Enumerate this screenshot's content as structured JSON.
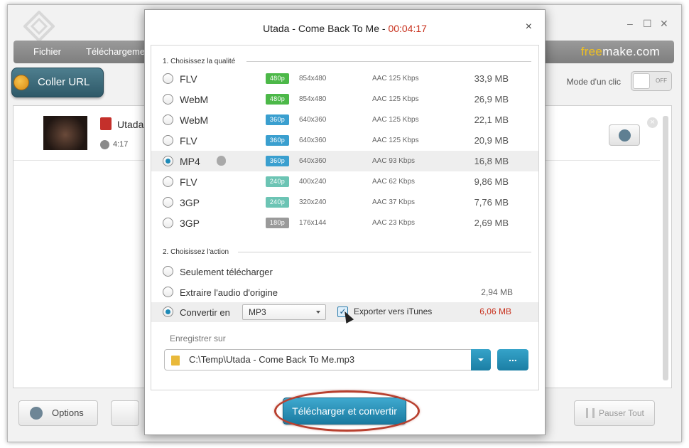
{
  "main_window": {
    "menu": [
      "Fichier",
      "Téléchargeme"
    ],
    "brand": {
      "prefix": "free",
      "suffix": "make.com"
    },
    "paste_url_label": "Coller URL",
    "one_click": {
      "label": "Mode d'un clic",
      "state": "OFF"
    },
    "item": {
      "title": "Utada",
      "duration": "4:17"
    },
    "options_label": "Options",
    "pause_all_label": "Pauser Tout"
  },
  "dialog": {
    "title": "Utada - Come Back To Me",
    "time": "00:04:17",
    "close": "×",
    "section1": "1. Choisissez la qualité",
    "qualities": [
      {
        "format": "FLV",
        "badge": "480p",
        "badge_color": "#4cb848",
        "resolution": "854x480",
        "audio": "AAC 125  Kbps",
        "size": "33,9 MB",
        "selected": false,
        "apple": false
      },
      {
        "format": "WebM",
        "badge": "480p",
        "badge_color": "#4cb848",
        "resolution": "854x480",
        "audio": "AAC 125  Kbps",
        "size": "26,9 MB",
        "selected": false,
        "apple": false
      },
      {
        "format": "WebM",
        "badge": "360p",
        "badge_color": "#3a9fcf",
        "resolution": "640x360",
        "audio": "AAC 125  Kbps",
        "size": "22,1 MB",
        "selected": false,
        "apple": false
      },
      {
        "format": "FLV",
        "badge": "360p",
        "badge_color": "#3a9fcf",
        "resolution": "640x360",
        "audio": "AAC 125  Kbps",
        "size": "20,9 MB",
        "selected": false,
        "apple": false
      },
      {
        "format": "MP4",
        "badge": "360p",
        "badge_color": "#3a9fcf",
        "resolution": "640x360",
        "audio": "AAC 93  Kbps",
        "size": "16,8 MB",
        "selected": true,
        "apple": true
      },
      {
        "format": "FLV",
        "badge": "240p",
        "badge_color": "#6cc4b4",
        "resolution": "400x240",
        "audio": "AAC 62  Kbps",
        "size": "9,86 MB",
        "selected": false,
        "apple": false
      },
      {
        "format": "3GP",
        "badge": "240p",
        "badge_color": "#6cc4b4",
        "resolution": "320x240",
        "audio": "AAC 37  Kbps",
        "size": "7,76 MB",
        "selected": false,
        "apple": false
      },
      {
        "format": "3GP",
        "badge": "180p",
        "badge_color": "#9a9a9a",
        "resolution": "176x144",
        "audio": "AAC 23  Kbps",
        "size": "2,69 MB",
        "selected": false,
        "apple": false
      }
    ],
    "section2": "2. Choisissez l'action",
    "actions": {
      "download_only": "Seulement télécharger",
      "extract_audio": "Extraire l'audio d'origine",
      "extract_size": "2,94 MB",
      "convert": "Convertir en",
      "convert_format": "MP3",
      "itunes_label": "Exporter vers iTunes",
      "itunes_checked": true,
      "convert_size": "6,06 MB"
    },
    "save_label": "Enregistrer sur",
    "save_path": "C:\\Temp\\Utada - Come Back To Me.mp3",
    "browse_label": "...",
    "submit_label": "Télécharger et convertir"
  }
}
